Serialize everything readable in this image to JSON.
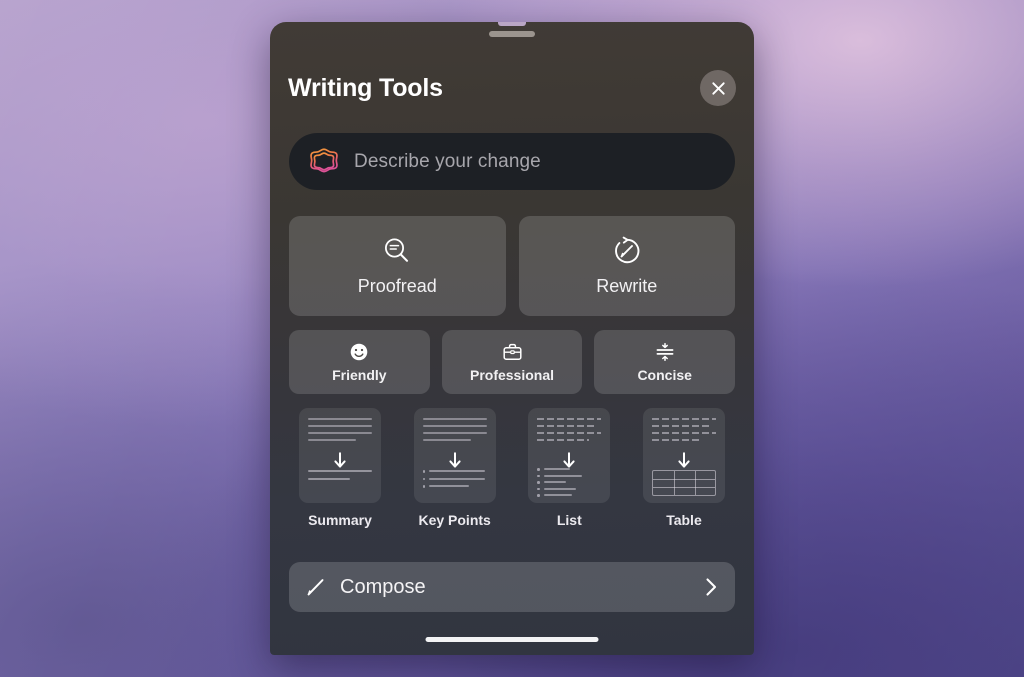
{
  "wallpaper": {
    "gradient_from": "#c4aed2",
    "gradient_mid": "#8878bb",
    "gradient_to": "#514a90"
  },
  "sheet": {
    "background_top": "#413b36",
    "background_bottom": "#313540",
    "grabber": "grabber-handle",
    "home_indicator": "home-indicator"
  },
  "header": {
    "title": "Writing Tools",
    "close_icon": "close-icon"
  },
  "prompt": {
    "placeholder": "Describe your change",
    "icon": "apple-intelligence-icon",
    "value": ""
  },
  "primary_actions": [
    {
      "label": "Proofread",
      "icon": "proofread-magnifier-icon"
    },
    {
      "label": "Rewrite",
      "icon": "rewrite-rotate-pen-icon"
    }
  ],
  "tone_actions": [
    {
      "label": "Friendly",
      "icon": "smiley-face-icon"
    },
    {
      "label": "Professional",
      "icon": "briefcase-icon"
    },
    {
      "label": "Concise",
      "icon": "compress-arrows-icon"
    }
  ],
  "transform_cards": [
    {
      "label": "Summary",
      "icon": "summary-thumbnail-icon"
    },
    {
      "label": "Key Points",
      "icon": "key-points-thumbnail-icon"
    },
    {
      "label": "List",
      "icon": "list-thumbnail-icon"
    },
    {
      "label": "Table",
      "icon": "table-thumbnail-icon"
    }
  ],
  "compose": {
    "label": "Compose",
    "leading_icon": "pencil-icon",
    "trailing_icon": "chevron-right-icon"
  },
  "colors": {
    "accent_gradient_start": "#f0923c",
    "accent_gradient_end": "#e0538c",
    "panel_text": "#ffffff",
    "placeholder_text": "#a7a6ac"
  }
}
